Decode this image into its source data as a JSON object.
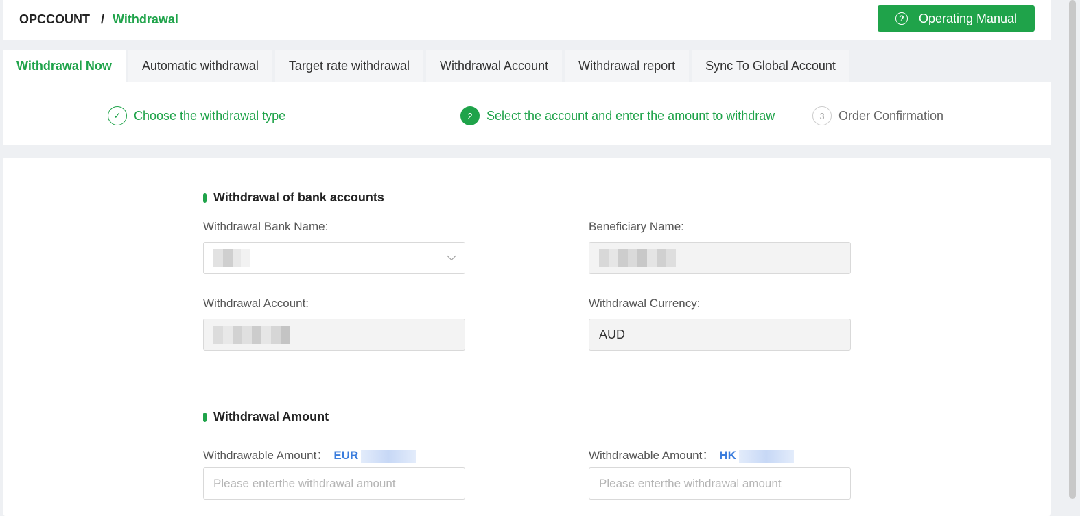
{
  "header": {
    "breadcrumb_root": "OPCCOUNT",
    "breadcrumb_sep": "/",
    "breadcrumb_current": "Withdrawal",
    "manual_button": "Operating Manual",
    "help_icon_glyph": "?"
  },
  "tabs": [
    {
      "label": "Withdrawal Now",
      "active": true
    },
    {
      "label": "Automatic withdrawal"
    },
    {
      "label": "Target rate withdrawal"
    },
    {
      "label": "Withdrawal Account"
    },
    {
      "label": "Withdrawal report"
    },
    {
      "label": "Sync To Global Account"
    }
  ],
  "steps": [
    {
      "num": "✓",
      "label": "Choose the withdrawal type"
    },
    {
      "num": "2",
      "label": "Select the account and enter the amount to withdraw"
    },
    {
      "num": "3",
      "label": "Order Confirmation"
    }
  ],
  "bank_section": {
    "title": "Withdrawal of bank accounts",
    "bank_name_label": "Withdrawal Bank Name:",
    "beneficiary_label": "Beneficiary Name:",
    "account_label": "Withdrawal Account:",
    "currency_label": "Withdrawal Currency:",
    "currency_value": "AUD"
  },
  "amount_section": {
    "title": "Withdrawal Amount",
    "left_label": "Withdrawable Amount：",
    "left_currency": "EUR",
    "right_label": "Withdrawable Amount：",
    "right_currency": "HK",
    "placeholder": "Please enterthe withdrawal amount"
  },
  "colors": {
    "accent": "#1fa34a",
    "link": "#3b7ddd"
  }
}
